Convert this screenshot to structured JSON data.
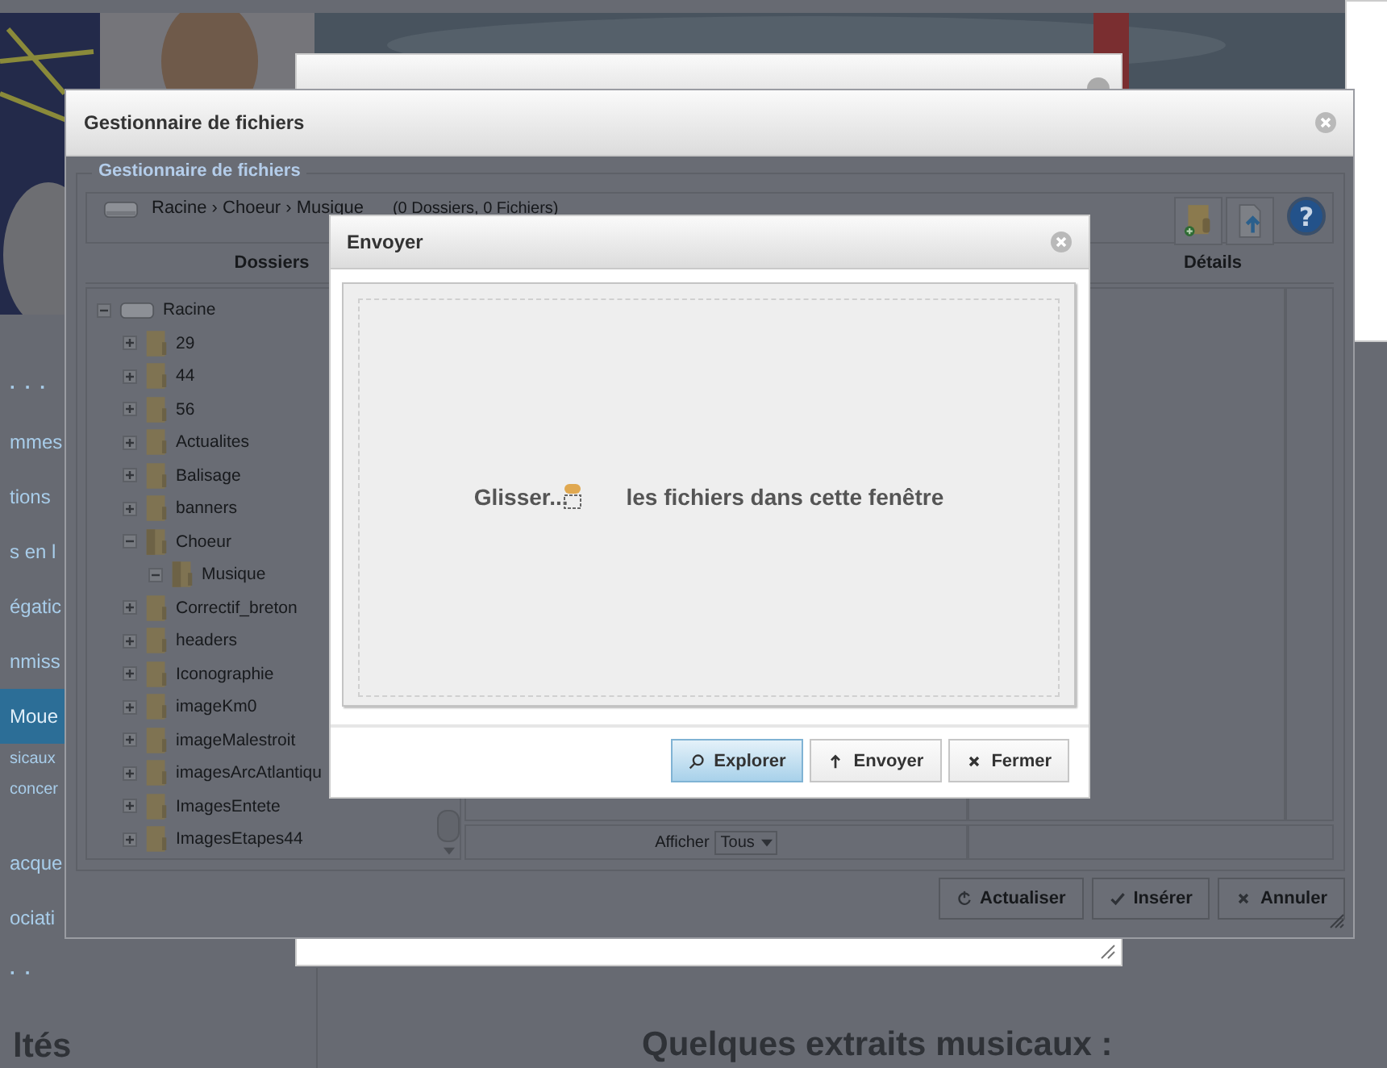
{
  "page": {
    "sidebar": [
      {
        "label": "· · ·",
        "kind": "dots",
        "selected": false
      },
      {
        "label": "mmes",
        "kind": "link",
        "selected": false
      },
      {
        "label": "tions",
        "kind": "link",
        "selected": false
      },
      {
        "label": "s en l",
        "kind": "link",
        "selected": false
      },
      {
        "label": "égatic",
        "kind": "link",
        "selected": false
      },
      {
        "label": "nmiss",
        "kind": "link",
        "selected": false
      },
      {
        "label": "Moue",
        "kind": "link",
        "selected": true
      },
      {
        "label": "sicaux",
        "kind": "sub",
        "selected": false
      },
      {
        "label": "concer",
        "kind": "sub",
        "selected": false
      },
      {
        "label": "acque",
        "kind": "link",
        "selected": false
      },
      {
        "label": "ociati",
        "kind": "link",
        "selected": false
      },
      {
        "label": "· ·",
        "kind": "dots",
        "selected": false
      }
    ],
    "side_heading": "ltés",
    "heading": "Quelques extraits musicaux :"
  },
  "file_manager": {
    "title": "Gestionnaire de fichiers",
    "legend": "Gestionnaire de fichiers",
    "breadcrumb": "Racine › Choeur › Musique",
    "counts": "(0 Dossiers, 0 Fichiers)",
    "help_label": "?",
    "columns": [
      "Dossiers",
      "Détails"
    ],
    "tree": [
      {
        "label": "Racine",
        "kind": "drive",
        "expanded": true,
        "children": [
          {
            "label": "29",
            "kind": "folder",
            "expanded": false
          },
          {
            "label": "44",
            "kind": "folder",
            "expanded": false
          },
          {
            "label": "56",
            "kind": "folder",
            "expanded": false
          },
          {
            "label": "Actualites",
            "kind": "folder",
            "expanded": false
          },
          {
            "label": "Balisage",
            "kind": "folder",
            "expanded": false
          },
          {
            "label": "banners",
            "kind": "folder",
            "expanded": false
          },
          {
            "label": "Choeur",
            "kind": "folder",
            "expanded": true,
            "children": [
              {
                "label": "Musique",
                "kind": "folder",
                "expanded": true
              }
            ]
          },
          {
            "label": "Correctif_breton",
            "kind": "folder",
            "expanded": false
          },
          {
            "label": "headers",
            "kind": "folder",
            "expanded": false
          },
          {
            "label": "Iconographie",
            "kind": "folder",
            "expanded": false
          },
          {
            "label": "imageKm0",
            "kind": "folder",
            "expanded": false
          },
          {
            "label": "imageMalestroit",
            "kind": "folder",
            "expanded": false
          },
          {
            "label": "imagesArcAtlantiqu",
            "kind": "folder",
            "expanded": false
          },
          {
            "label": "ImagesEntete",
            "kind": "folder",
            "expanded": false
          },
          {
            "label": "ImagesEtapes44",
            "kind": "folder",
            "expanded": false
          }
        ]
      }
    ],
    "filter_label": "Afficher",
    "filter_value": "Tous",
    "buttons": [
      {
        "label": "Actualiser",
        "kind": "refresh"
      },
      {
        "label": "Insérer",
        "kind": "check"
      },
      {
        "label": "Annuler",
        "kind": "cancel"
      }
    ]
  },
  "upload_dialog": {
    "title": "Envoyer",
    "drop_text_start": "Glisser...",
    "drop_text_end": "les fichiers dans cette fenêtre",
    "buttons": [
      {
        "label": "Explorer",
        "kind": "browse",
        "selected": true
      },
      {
        "label": "Envoyer",
        "kind": "upload",
        "selected": false
      },
      {
        "label": "Fermer",
        "kind": "cancel",
        "selected": false
      }
    ]
  }
}
